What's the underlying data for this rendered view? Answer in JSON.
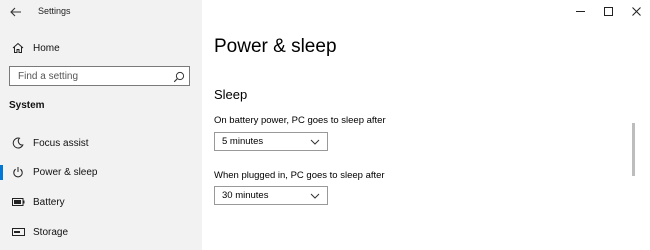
{
  "window": {
    "title": "Settings",
    "controls": [
      "minimize",
      "maximize",
      "close"
    ]
  },
  "sidebar": {
    "home_label": "Home",
    "search_placeholder": "Find a setting",
    "section_header": "System",
    "items": [
      {
        "label": "Focus assist",
        "icon": "moon-icon"
      },
      {
        "label": "Power & sleep",
        "icon": "power-icon",
        "selected": true
      },
      {
        "label": "Battery",
        "icon": "battery-icon"
      },
      {
        "label": "Storage",
        "icon": "storage-icon"
      }
    ]
  },
  "main": {
    "title": "Power & sleep",
    "section_title": "Sleep",
    "battery_label": "On battery power, PC goes to sleep after",
    "battery_value": "5 minutes",
    "plugged_label": "When plugged in, PC goes to sleep after",
    "plugged_value": "30 minutes"
  },
  "colors": {
    "accent": "#0078d7",
    "sidebar_bg": "#f2f2f2"
  }
}
